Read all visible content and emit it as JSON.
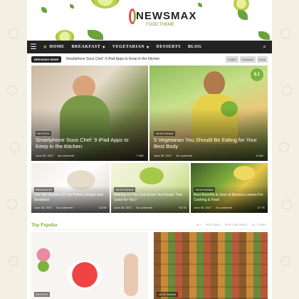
{
  "logo": {
    "title": "NEWSMAX",
    "subtitle": "FOOD THEME"
  },
  "nav": {
    "items": [
      "HOME",
      "BREAKFAST",
      "VEGETARIAN",
      "DESSERTS",
      "BLOG"
    ]
  },
  "ticker": {
    "label": "BREAKING NEWS",
    "text": "Smartphone Sous Chef: 9 iPad Apps to Keep in the Kitchen",
    "tags": [
      "Coffee",
      "Featured",
      "Soup"
    ]
  },
  "featured": [
    {
      "category": "RECIPES",
      "title": "Smartphone Sous Chef: 9 iPad Apps to Keep in the Kitchen",
      "date": "June 30, 2017",
      "comments": "No comment",
      "count": "7.28K"
    },
    {
      "category": "VEGETARIAN",
      "title": "5 Vegetarian You Should Be Eating for Your Best Body",
      "date": "June 30, 2017",
      "comments": "No comment",
      "count": "10.8K",
      "badge": "8.1"
    }
  ],
  "row": [
    {
      "category": "BREAKFAST",
      "title": "The Top Secrets Of The Perfect Weight loss Breakfast",
      "date": "June 30, 2017",
      "comments": "No comment",
      "count": "62.6K"
    },
    {
      "category": "VEGETARIAN",
      "title": "Matcha: Is This Cult Green Tea Ready That Good for You?",
      "date": "June 30, 2017",
      "comments": "No comment",
      "count": "53.7K"
    },
    {
      "category": "VEGETARIAN",
      "title": "Best Benefits & Uses of Banana Leaves For Cooking & Food",
      "date": "June 30, 2017",
      "comments": "No comment",
      "count": "27.7K"
    }
  ],
  "popular": {
    "heading": "Top Popular",
    "tabs": [
      "ALL",
      "FEATURED",
      "POPULAR WEEK",
      "ALL TIMES"
    ],
    "cards": [
      {
        "category": "RECIPES"
      },
      {
        "category": "VEGETARIAN"
      }
    ]
  }
}
